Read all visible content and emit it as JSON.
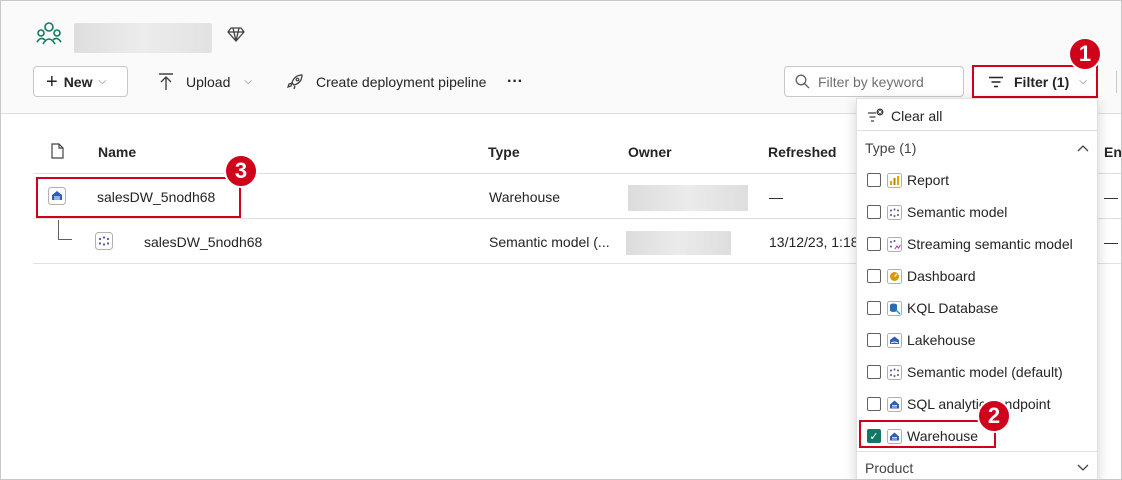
{
  "toolbar": {
    "new_label": "New",
    "upload_label": "Upload",
    "pipeline_label": "Create deployment pipeline",
    "more_label": "···",
    "search_placeholder": "Filter by keyword",
    "filter_label": "Filter (1)"
  },
  "table": {
    "headers": {
      "name": "Name",
      "type": "Type",
      "owner": "Owner",
      "refreshed": "Refreshed",
      "endorsement": "En"
    },
    "rows": [
      {
        "name": "salesDW_5nodh68",
        "type": "Warehouse",
        "refreshed": "—",
        "endorsement": "—",
        "icon": "warehouse-icon"
      },
      {
        "name": "salesDW_5nodh68",
        "type": "Semantic model (...",
        "refreshed": "13/12/23, 1:18",
        "endorsement": "—",
        "icon": "semantic-model-icon"
      }
    ]
  },
  "filter_panel": {
    "clear_all": "Clear all",
    "type_section": "Type (1)",
    "product_section": "Product",
    "options": [
      {
        "label": "Report",
        "checked": false,
        "icon": "report-icon"
      },
      {
        "label": "Semantic model",
        "checked": false,
        "icon": "semantic-model-icon"
      },
      {
        "label": "Streaming semantic model",
        "checked": false,
        "icon": "streaming-semantic-model-icon"
      },
      {
        "label": "Dashboard",
        "checked": false,
        "icon": "dashboard-icon"
      },
      {
        "label": "KQL Database",
        "checked": false,
        "icon": "kql-database-icon"
      },
      {
        "label": "Lakehouse",
        "checked": false,
        "icon": "lakehouse-icon"
      },
      {
        "label": "Semantic model (default)",
        "checked": false,
        "icon": "semantic-model-icon"
      },
      {
        "label": "SQL analytics endpoint",
        "checked": false,
        "icon": "sql-endpoint-icon"
      },
      {
        "label": "Warehouse",
        "checked": true,
        "icon": "warehouse-icon"
      }
    ]
  },
  "callouts": {
    "one": "1",
    "two": "2",
    "three": "3"
  },
  "colors": {
    "highlight": "#d0021b",
    "checked": "#117865",
    "warehouse_blue": "#2b5fb4"
  }
}
